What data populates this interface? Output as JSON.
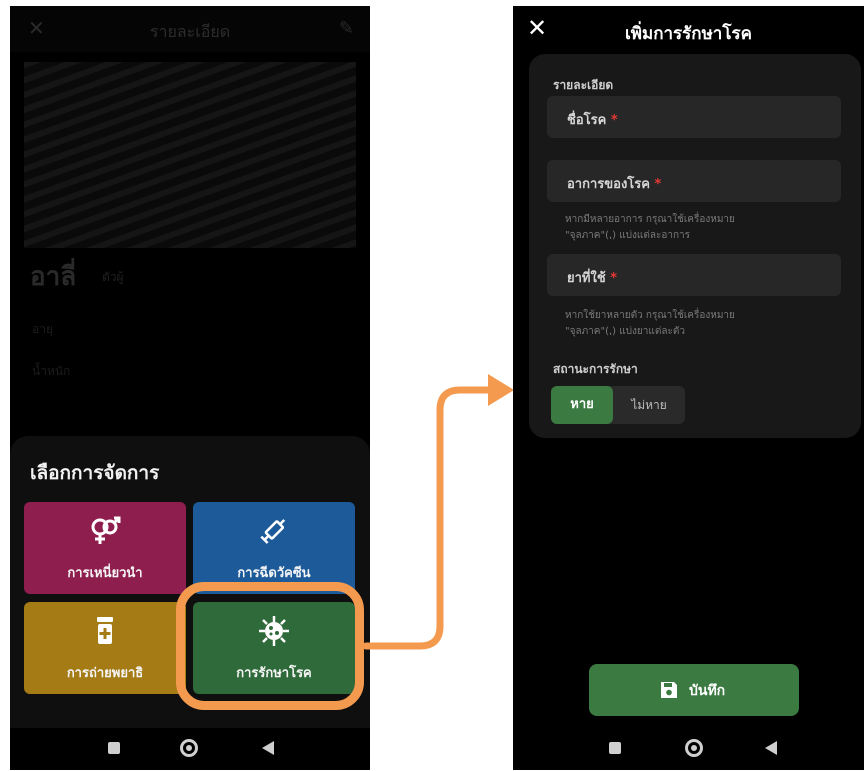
{
  "left_screen": {
    "header_title": "รายละเอียด",
    "animal_name": "อาลี่",
    "animal_tag": "ตัวผู้",
    "info_rows": [
      "อายุ",
      "น้ำหนัก"
    ],
    "sheet_title": "เลือกการจัดการ",
    "tiles": [
      {
        "label": "การเหนี่ยวนำ",
        "icon": "gender-icon",
        "color": "#8e1e4e"
      },
      {
        "label": "การฉีดวัคซีน",
        "icon": "syringe-icon",
        "color": "#1d5a9a"
      },
      {
        "label": "การถ่ายพยาธิ",
        "icon": "medicine-bottle-icon",
        "color": "#a47b15"
      },
      {
        "label": "การรักษาโรค",
        "icon": "virus-icon",
        "color": "#2f6a3a"
      }
    ],
    "highlight_color": "#f49a4f"
  },
  "right_screen": {
    "title": "เพิ่มการรักษาโรค",
    "section_label": "รายละเอียด",
    "fields": [
      {
        "label": "ชื่อโรค",
        "required_mark": "*"
      },
      {
        "label": "อาการของโรค",
        "required_mark": "*",
        "hint_line1": "หากมีหลายอาการ กรุณาใช้เครื่องหมาย",
        "hint_line2": "\"จุลภาค\"(,) แบ่งแต่ละอาการ"
      },
      {
        "label": "ยาที่ใช้",
        "required_mark": "*",
        "hint_line1": "หากใช้ยาหลายตัว กรุณาใช้เครื่องหมาย",
        "hint_line2": "\"จุลภาค\"(,) แบ่งยาแต่ละตัว"
      }
    ],
    "status_label": "สถานะการรักษา",
    "status_options": {
      "selected": "หาย",
      "other": "ไม่หาย"
    },
    "save_label": "บันทึก",
    "accent_color": "#3b7a41"
  }
}
